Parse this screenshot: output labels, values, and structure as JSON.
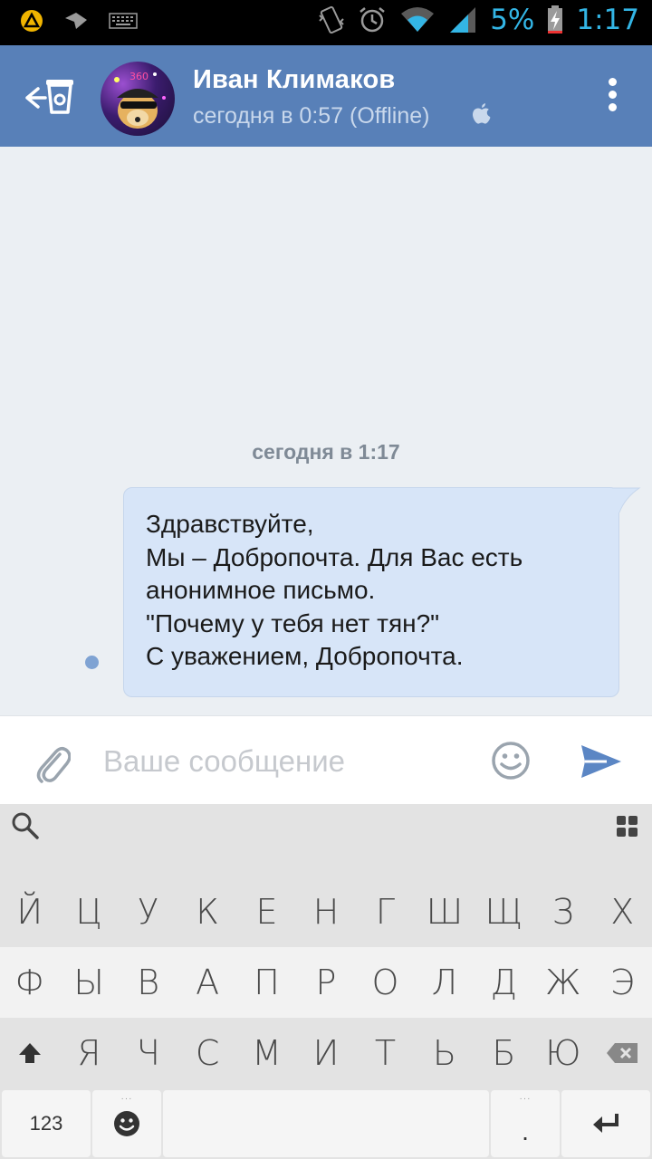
{
  "status_bar": {
    "battery_percent": "5%",
    "time": "1:17",
    "icons": [
      "app-notification-icon",
      "send-icon",
      "keyboard-icon",
      "vibrate-icon",
      "alarm-icon",
      "wifi-icon",
      "signal-icon",
      "battery-charging-icon"
    ]
  },
  "header": {
    "contact_name": "Иван Климаков",
    "last_seen": "сегодня в 0:57 (Offline)",
    "back_icon": "back-arrow-cup-icon",
    "platform_icon": "apple-icon",
    "menu_icon": "overflow-menu-icon"
  },
  "chat": {
    "date_separator": "сегодня в 1:17",
    "messages": [
      {
        "text": "Здравствуйте,\nМы – Добропочта. Для Вас есть анонимное письмо.\n\"Почему у тебя нет тян?\"\nС уважением, Добропочта.",
        "outgoing": false,
        "unread": true
      }
    ]
  },
  "compose": {
    "placeholder": "Ваше сообщение",
    "value": "",
    "attach_icon": "paperclip-icon",
    "emoji_icon": "smiley-icon",
    "send_icon": "send-arrow-icon"
  },
  "keyboard": {
    "row1": [
      "Й",
      "Ц",
      "У",
      "К",
      "Е",
      "Н",
      "Г",
      "Ш",
      "Щ",
      "З",
      "Х"
    ],
    "row2": [
      "Ф",
      "Ы",
      "В",
      "А",
      "П",
      "Р",
      "О",
      "Л",
      "Д",
      "Ж",
      "Э"
    ],
    "row3_letters": [
      "Я",
      "Ч",
      "С",
      "М",
      "И",
      "Т",
      "Ь",
      "Б",
      "Ю"
    ],
    "numbers_key": "123",
    "period_key": ".",
    "colors": {
      "accent": "#5880b8",
      "bubble": "#d7e5f8",
      "send": "#5b86c4"
    }
  }
}
